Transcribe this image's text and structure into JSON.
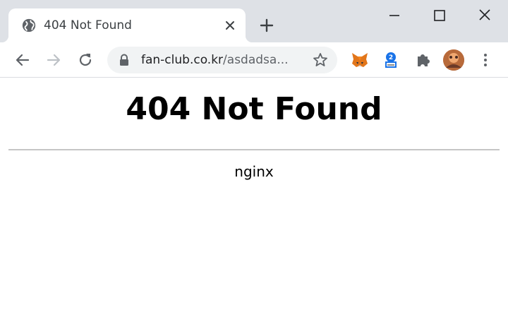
{
  "browser": {
    "tab": {
      "title": "404 Not Found",
      "favicon": "globe-icon",
      "close_icon": "close-icon"
    },
    "new_tab_icon": "plus-icon",
    "window_controls": [
      "minimize-icon",
      "maximize-icon",
      "close-icon"
    ],
    "toolbar": {
      "back_icon": "arrow-left-icon",
      "forward_icon": "arrow-right-icon",
      "reload_icon": "reload-icon",
      "address": {
        "lock_icon": "lock-icon",
        "host": "fan-club.co.kr",
        "path": "/asdadsa...",
        "bookmark_icon": "star-icon"
      },
      "extensions": [
        "metamask-fox-icon",
        "extension-icon",
        "puzzle-icon"
      ],
      "profile_avatar": "avatar",
      "menu_icon": "kebab-menu-icon"
    }
  },
  "page": {
    "heading": "404 Not Found",
    "server": "nginx"
  },
  "colors": {
    "tabstrip_bg": "#dee1e6",
    "omnibox_bg": "#f1f3f4",
    "icon": "#5f6368",
    "divider": "#c6c6c6"
  }
}
